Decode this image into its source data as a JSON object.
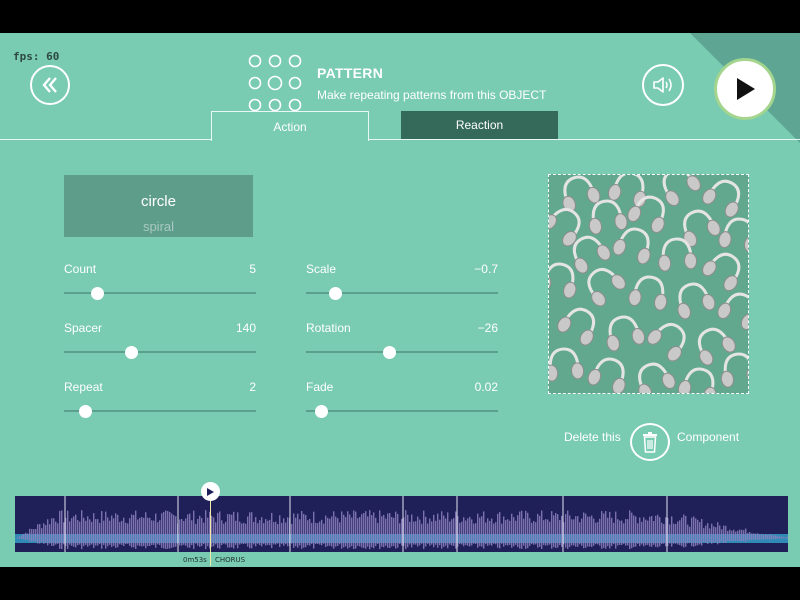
{
  "debug": {
    "fps_label": "fps: 60"
  },
  "header": {
    "title": "PATTERN",
    "subtitle": "Make repeating patterns from this OBJECT",
    "icons": {
      "back": "back-chevron-icon",
      "sound": "speaker-icon",
      "play": "play-icon",
      "pattern": "pattern-dots-icon"
    }
  },
  "tabs": [
    {
      "label": "Action",
      "active": true
    },
    {
      "label": "Reaction",
      "active": false
    }
  ],
  "shape_picker": {
    "current": "circle",
    "next": "spiral"
  },
  "params": {
    "count": {
      "label": "Count",
      "value": "5",
      "level": 0.17
    },
    "spacer": {
      "label": "Spacer",
      "value": "140",
      "level": 0.35
    },
    "repeat": {
      "label": "Repeat",
      "value": "2",
      "level": 0.11
    },
    "scale": {
      "label": "Scale",
      "value": "−0.7",
      "level": 0.15
    },
    "rotation": {
      "label": "Rotation",
      "value": "−26",
      "level": 0.43
    },
    "fade": {
      "label": "Fade",
      "value": "0.02",
      "level": 0.08
    }
  },
  "preview": {
    "object_icon": "headphones-icon"
  },
  "delete": {
    "left": "Delete this",
    "right": "Component",
    "icon": "trash-icon"
  },
  "timeline": {
    "time": "0m53s",
    "section": "CHORUS",
    "playhead_fraction": 0.254
  },
  "colors": {
    "background": "#79cbb1",
    "dark_tab": "#356a5a",
    "waveform_bg": "#1f2057",
    "waveform_fg": "#8c7fbf"
  }
}
